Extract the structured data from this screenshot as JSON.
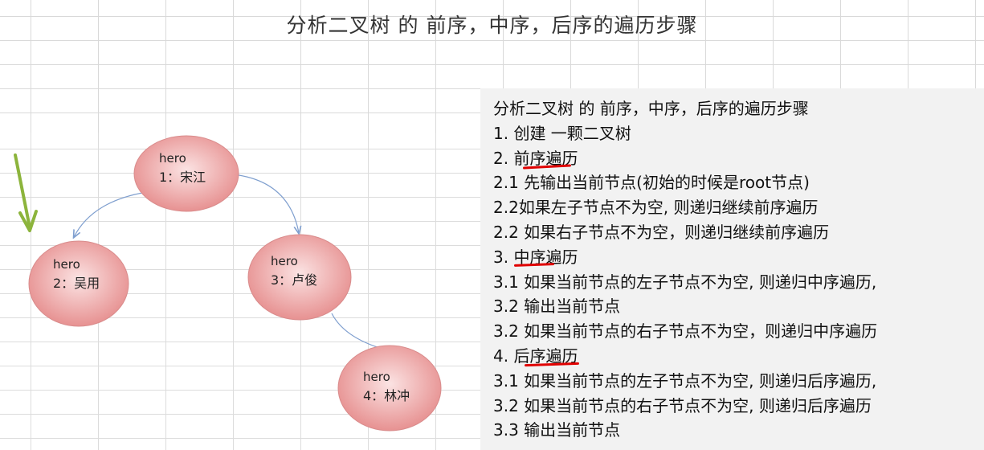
{
  "title": "分析二叉树 的 前序，中序，后序的遍历步骤",
  "colors": {
    "node_fill_center": "#fbe3e3",
    "node_fill_edge": "#e58a8a",
    "node_stroke": "#d98c8c",
    "edge": "#7f9fcf",
    "arrow": "#8cb43c",
    "underline": "#e00000"
  },
  "nodes": [
    {
      "id": "n1",
      "name": "hero",
      "label": "1：宋江"
    },
    {
      "id": "n2",
      "name": "hero",
      "label": "2：吴用"
    },
    {
      "id": "n3",
      "name": "hero",
      "label": "3：卢俊"
    },
    {
      "id": "n4",
      "name": "hero",
      "label": "4：林冲"
    }
  ],
  "edges": [
    {
      "from": "n1",
      "to": "n2"
    },
    {
      "from": "n1",
      "to": "n3"
    },
    {
      "from": "n3",
      "to": "n4"
    }
  ],
  "steps": {
    "heading": "分析二叉树 的 前序，中序，后序的遍历步骤",
    "lines": [
      "1. 创建 一颗二叉树",
      "2. 前序遍历",
      "2.1 先输出当前节点(初始的时候是root节点)",
      "2.2如果左子节点不为空, 则递归继续前序遍历",
      "2.2 如果右子节点不为空，则递归继续前序遍历",
      "3. 中序遍历",
      "3.1  如果当前节点的左子节点不为空, 则递归中序遍历,",
      "3.2  输出当前节点",
      "3.2 如果当前节点的右子节点不为空，则递归中序遍历",
      "4. 后序遍历",
      "3.1  如果当前节点的左子节点不为空, 则递归后序遍历,",
      "3.2  如果当前节点的右子节点不为空, 则递归后序遍历",
      "3.3 输出当前节点"
    ]
  }
}
